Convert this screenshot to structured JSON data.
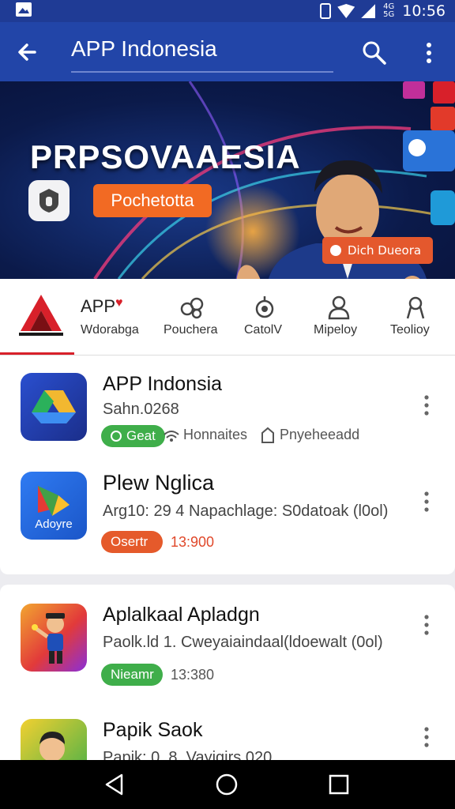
{
  "status_bar": {
    "time": "10:56",
    "sim_label": "4G 5G"
  },
  "app_bar": {
    "title": "APP Indonesia"
  },
  "banner": {
    "headline": "PRPSOVAAESIA",
    "cta_label": "Pochetotta",
    "badge_label": "Dich Dueora"
  },
  "categories": {
    "main": {
      "title": "APP",
      "label": "Wdorabga"
    },
    "items": [
      {
        "label": "Pouchera"
      },
      {
        "label": "CatolV"
      },
      {
        "label": "Mipeloy"
      },
      {
        "label": "Teolioy"
      }
    ]
  },
  "apps": [
    {
      "name": "APP Indonsia",
      "meta": "Sahn.0268",
      "pill": "Geat",
      "tag1": "Honnaites",
      "tag2": "Pnyeheeadd"
    },
    {
      "name": "Plew Nglica",
      "meta": "Arg10: 29 4  Napachlage: S0datoak (l0ol)",
      "icon_text": "Adoyre",
      "pill": "Osertr",
      "value": "13:900"
    },
    {
      "name": "Aplalkaal Apladgn",
      "meta": "Paolk.ld 1. Cweyaiaindaal(ldoewalt (0ol)",
      "pill": "Nieamr",
      "value": "13:380"
    },
    {
      "name": "Papik Saok",
      "meta": "Papik: 0. 8. Vayigirs 020"
    }
  ],
  "colors": {
    "app_bar": "#2245a8",
    "status_bar": "#1f3b95",
    "accent_red": "#d8202a",
    "cta_orange": "#f26a23",
    "pill_green": "#3fae4a",
    "pill_orange": "#e55a2b"
  }
}
